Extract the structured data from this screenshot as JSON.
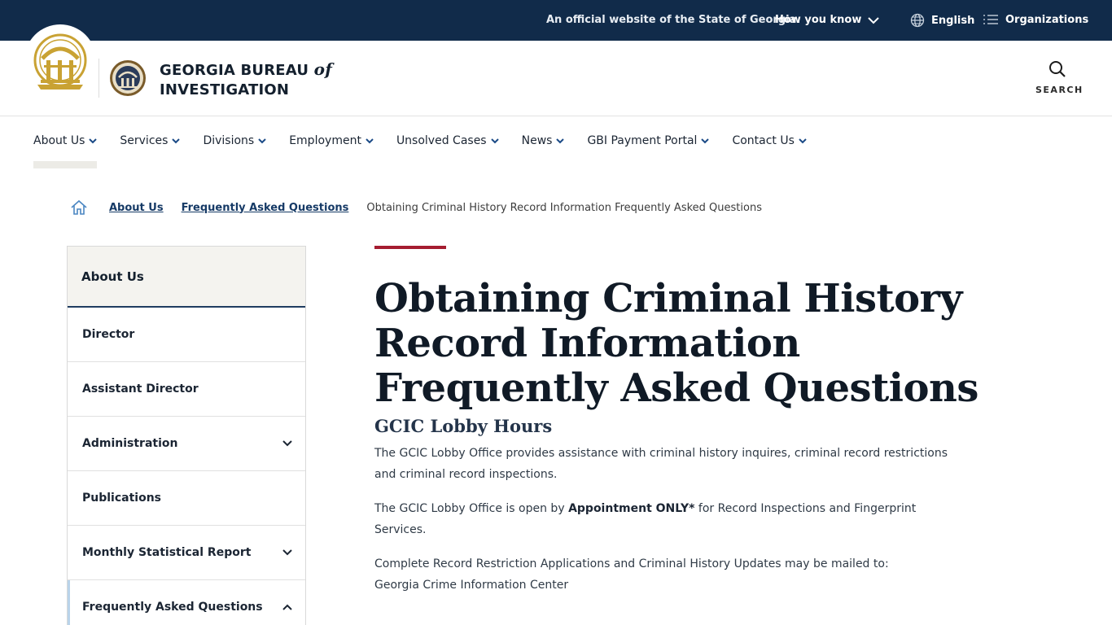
{
  "topbar": {
    "official_text": "An official website of the State of Georgia.",
    "how_you_know": "How you know",
    "language": "English",
    "organizations": "Organizations"
  },
  "header": {
    "agency_line1": "GEORGIA BUREAU",
    "agency_of": "of",
    "agency_line2": "INVESTIGATION",
    "search_label": "SEARCH"
  },
  "nav": {
    "items": [
      {
        "label": "About Us"
      },
      {
        "label": "Services"
      },
      {
        "label": "Divisions"
      },
      {
        "label": "Employment"
      },
      {
        "label": "Unsolved Cases"
      },
      {
        "label": "News"
      },
      {
        "label": "GBI Payment Portal"
      },
      {
        "label": "Contact Us"
      }
    ]
  },
  "breadcrumb": {
    "links": [
      "About Us",
      "Frequently Asked Questions"
    ],
    "current": "Obtaining Criminal History Record Information Frequently Asked Questions"
  },
  "sidebar": {
    "heading": "About Us",
    "items": [
      {
        "label": "Director"
      },
      {
        "label": "Assistant Director"
      },
      {
        "label": "Administration"
      },
      {
        "label": "Publications"
      },
      {
        "label": "Monthly Statistical Report"
      },
      {
        "label": "Frequently Asked Questions"
      }
    ]
  },
  "main": {
    "title": "Obtaining Criminal History Record Information Frequently Asked Questions",
    "section_heading": "GCIC Lobby Hours",
    "para1": "The GCIC Lobby Office provides assistance with criminal history inquires, criminal record restrictions and criminal record inspections.",
    "para2_pre": "The GCIC Lobby Office is open by ",
    "para2_bold": "Appointment ONLY*",
    "para2_post": " for Record Inspections and Fingerprint Services.",
    "para3_line1": "Complete Record Restriction Applications and Criminal History Updates may be mailed to:",
    "para3_line2": "Georgia Crime Information Center"
  },
  "colors": {
    "topbar_bg": "#112b4a",
    "accent_red": "#a51c30",
    "link_blue": "#163a66",
    "seal_gold": "#c9a233"
  }
}
